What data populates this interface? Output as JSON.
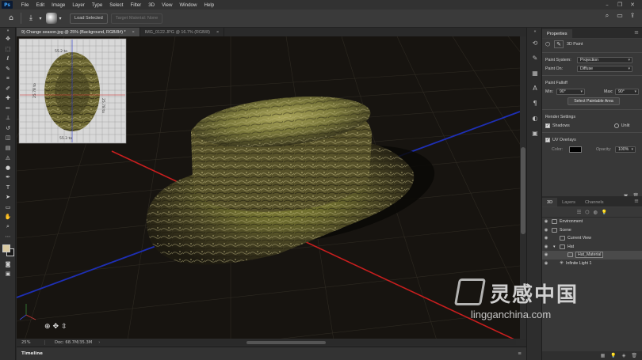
{
  "app": {
    "logo_text": "Ps",
    "menu": [
      "File",
      "Edit",
      "Image",
      "Layer",
      "Type",
      "Select",
      "Filter",
      "3D",
      "View",
      "Window",
      "Help"
    ]
  },
  "options": {
    "load_selected": "Load Selected",
    "target_material": "Target Material: None"
  },
  "tabs": [
    {
      "label": "9) Change season.jpg @ 25% (Background, RGB/8#) *",
      "active": true
    },
    {
      "label": "IMG_0122.JPG @ 16.7% (RGB/8)",
      "active": false
    }
  ],
  "status": {
    "zoom": "25%",
    "doc": "Doc: 68.7M/35.3M"
  },
  "timeline": {
    "label": "Timeline"
  },
  "properties": {
    "tab": "Properties",
    "mode_label": "3D Paint",
    "paint_system_label": "Paint System:",
    "paint_system_value": "Projection",
    "paint_on_label": "Paint On:",
    "paint_on_value": "Diffuse",
    "falloff_label": "Paint Falloff",
    "min_label": "Min:",
    "min_value": "90°",
    "max_label": "Max:",
    "max_value": "90°",
    "select_area_btn": "Select Paintable Area",
    "render_label": "Render Settings",
    "shadows_label": "Shadows",
    "unlit_label": "Unlit",
    "uv_label": "UV Overlays",
    "color_label": "Color:",
    "opacity_label": "Opacity:",
    "opacity_value": "100%"
  },
  "layers": {
    "tabs": [
      "3D",
      "Layers",
      "Channels"
    ],
    "items": [
      {
        "label": "Environment",
        "indent": 0
      },
      {
        "label": "Scene",
        "indent": 0
      },
      {
        "label": "Current View",
        "indent": 1
      },
      {
        "label": "Hat",
        "indent": 1
      },
      {
        "label": "Hat_Material",
        "indent": 2
      },
      {
        "label": "Infinite Light 1",
        "indent": 1
      }
    ]
  },
  "thumbnail": {
    "tick_labels": [
      "55.2 to",
      "55.3 to",
      "25.78 to",
      "25.78 to"
    ]
  },
  "watermark": {
    "cn": "灵感中国",
    "en": "lingganchina.com"
  },
  "colors": {
    "axis_red": "#c81e1e",
    "axis_blue": "#1e2fb4",
    "accent": "#3ea6ff"
  }
}
